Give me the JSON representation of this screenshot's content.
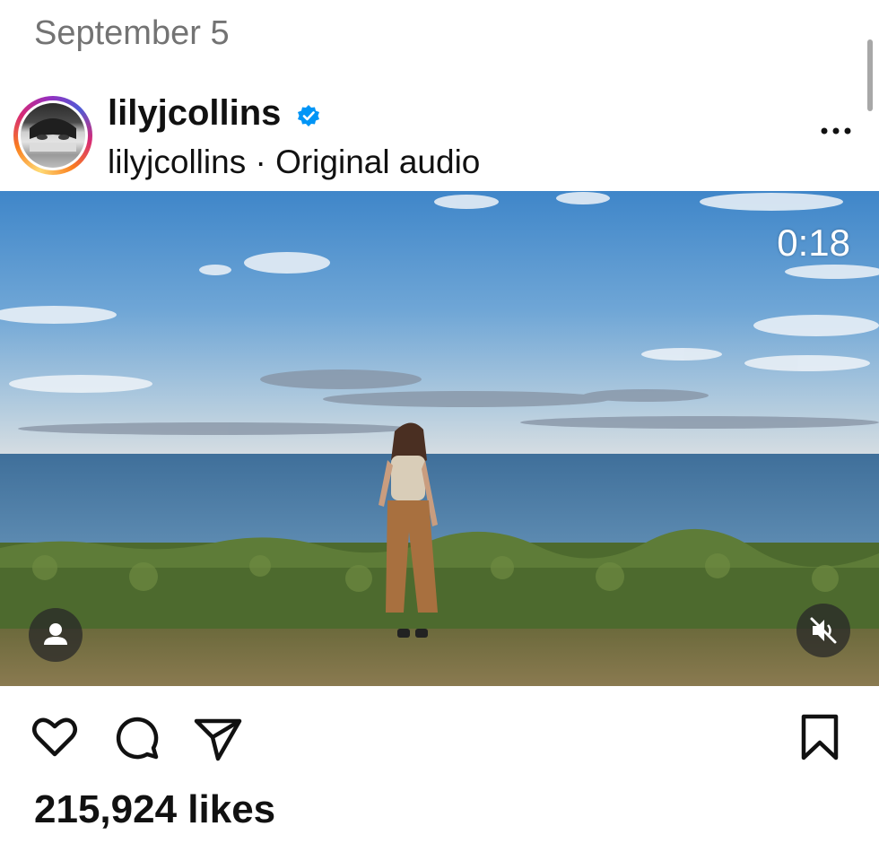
{
  "post": {
    "date": "September 5",
    "username": "lilyjcollins",
    "audio_line": "lilyjcollins · Original audio",
    "video_time": "0:18",
    "likes_text": "215,924 likes"
  },
  "icons": {
    "verified": "verified-badge-icon",
    "more": "more-options-icon",
    "tag": "tagged-people-icon",
    "mute": "muted-speaker-icon",
    "like": "heart-icon",
    "comment": "comment-icon",
    "share": "share-icon",
    "save": "bookmark-icon"
  },
  "colors": {
    "verified_blue": "#0095f6",
    "secondary_text": "#737373"
  }
}
